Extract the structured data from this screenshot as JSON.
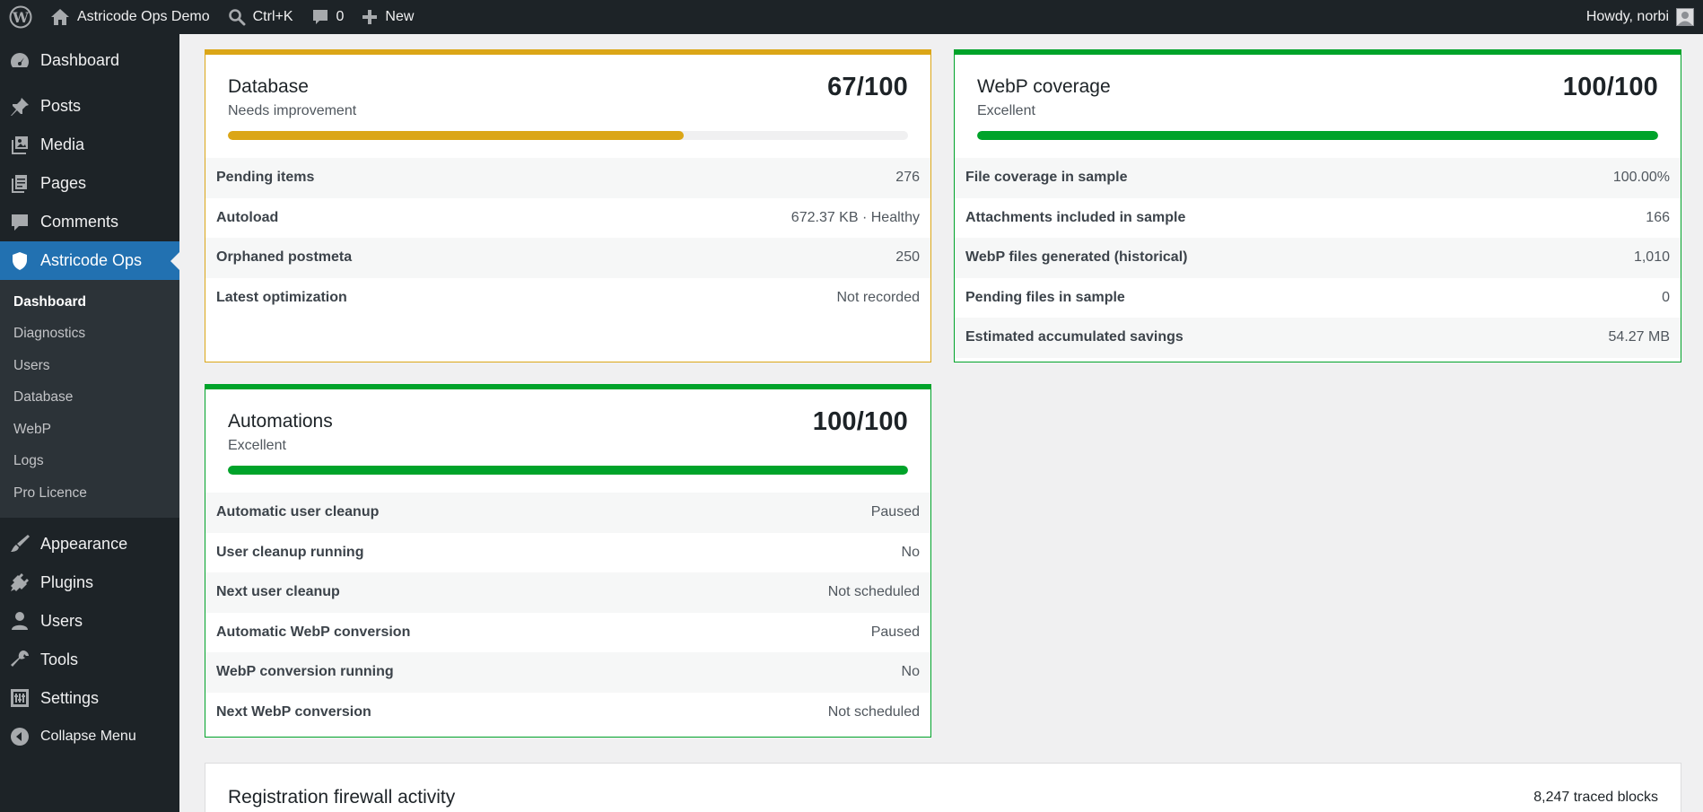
{
  "adminbar": {
    "site_name": "Astricode Ops Demo",
    "search_shortcut": "Ctrl+K",
    "comments_count": "0",
    "new_label": "New",
    "greeting": "Howdy, norbi"
  },
  "sidebar": {
    "items_top": [
      {
        "label": "Dashboard",
        "icon": "dashboard-icon"
      },
      {
        "label": "Posts",
        "icon": "pin-icon"
      },
      {
        "label": "Media",
        "icon": "media-icon"
      },
      {
        "label": "Pages",
        "icon": "pages-icon"
      },
      {
        "label": "Comments",
        "icon": "comment-icon"
      },
      {
        "label": "Astricode Ops",
        "icon": "shield-icon"
      }
    ],
    "submenu": [
      "Dashboard",
      "Diagnostics",
      "Users",
      "Database",
      "WebP",
      "Logs",
      "Pro Licence"
    ],
    "items_bottom": [
      {
        "label": "Appearance",
        "icon": "brush-icon"
      },
      {
        "label": "Plugins",
        "icon": "plug-icon"
      },
      {
        "label": "Users",
        "icon": "user-icon"
      },
      {
        "label": "Tools",
        "icon": "wrench-icon"
      },
      {
        "label": "Settings",
        "icon": "settings-icon"
      },
      {
        "label": "Collapse Menu",
        "icon": "collapse-icon"
      }
    ]
  },
  "cards": {
    "database": {
      "title": "Database",
      "status": "Needs improvement",
      "score": "67/100",
      "progress": 67,
      "color": "#dba617",
      "rows": [
        {
          "label": "Pending items",
          "value": "276"
        },
        {
          "label": "Autoload",
          "value": "672.37 KB · Healthy"
        },
        {
          "label": "Orphaned postmeta",
          "value": "250"
        },
        {
          "label": "Latest optimization",
          "value": "Not recorded"
        }
      ]
    },
    "webp": {
      "title": "WebP coverage",
      "status": "Excellent",
      "score": "100/100",
      "progress": 100,
      "color": "#00a32a",
      "rows": [
        {
          "label": "File coverage in sample",
          "value": "100.00%"
        },
        {
          "label": "Attachments included in sample",
          "value": "166"
        },
        {
          "label": "WebP files generated (historical)",
          "value": "1,010"
        },
        {
          "label": "Pending files in sample",
          "value": "0"
        },
        {
          "label": "Estimated accumulated savings",
          "value": "54.27 MB"
        }
      ]
    },
    "automations": {
      "title": "Automations",
      "status": "Excellent",
      "score": "100/100",
      "progress": 100,
      "color": "#00a32a",
      "rows": [
        {
          "label": "Automatic user cleanup",
          "value": "Paused"
        },
        {
          "label": "User cleanup running",
          "value": "No"
        },
        {
          "label": "Next user cleanup",
          "value": "Not scheduled"
        },
        {
          "label": "Automatic WebP conversion",
          "value": "Paused"
        },
        {
          "label": "WebP conversion running",
          "value": "No"
        },
        {
          "label": "Next WebP conversion",
          "value": "Not scheduled"
        }
      ]
    },
    "firewall": {
      "title": "Registration firewall activity",
      "summary": "8,247 traced blocks"
    }
  }
}
